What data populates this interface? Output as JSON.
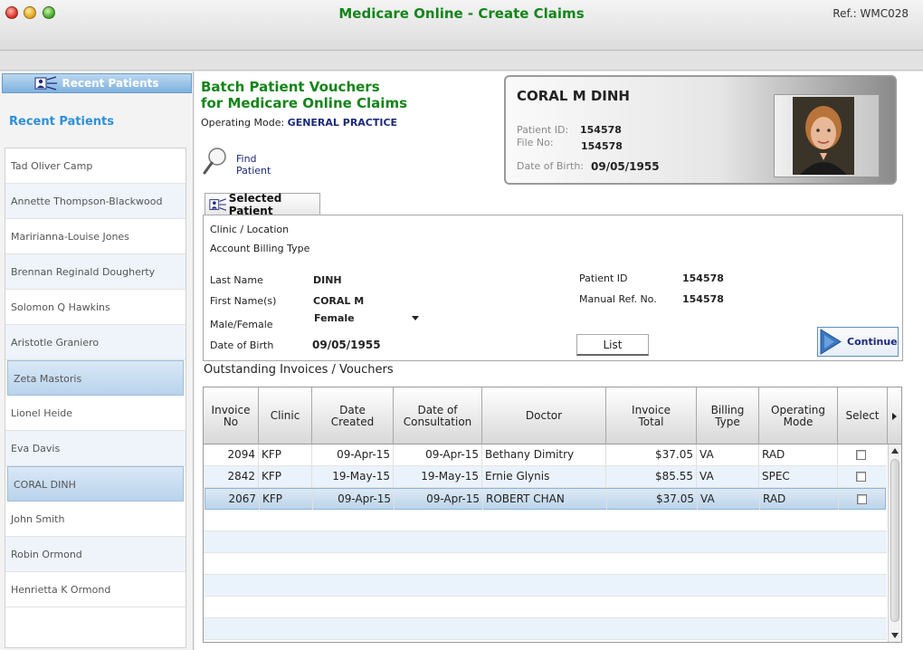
{
  "window": {
    "title": "Medicare Online - Create Claims",
    "ref": "Ref.: WMC028",
    "colors": {
      "title_green": "#14851a",
      "accent_blue": "#2e8fd8",
      "navy": "#1c2a7a"
    }
  },
  "sidebar": {
    "header": "Recent Patients",
    "title": "Recent Patients",
    "items": [
      "Tad Oliver Camp",
      "Annette Thompson-Blackwood",
      "Maririanna-Louise Jones",
      "Brennan Reginald Dougherty",
      "Solomon Q Hawkins",
      "Aristotle Graniero",
      "Zeta Mastoris",
      "Lionel Heide",
      "Eva Davis",
      "CORAL DINH",
      "John Smith",
      "Robin Ormond",
      "Henrietta K Ormond"
    ]
  },
  "main": {
    "batch_title_line1": "Batch Patient Vouchers",
    "batch_title_line2": "for Medicare Online Claims",
    "op_mode_label": "Operating Mode:",
    "op_mode_value": "GENERAL PRACTICE",
    "find_patient": "Find Patient"
  },
  "patient_card": {
    "name": "CORAL M DINH",
    "patient_id_label": "Patient ID:",
    "patient_id": "154578",
    "file_no_label": "File No:",
    "file_no": "154578",
    "dob_label": "Date of Birth:",
    "dob": "09/05/1955"
  },
  "selected_patient": {
    "tab": "Selected Patient",
    "clinic_label": "Clinic / Location",
    "billing_label": "Account Billing Type",
    "last_name_label": "Last Name",
    "last_name": "DINH",
    "first_name_label": "First Name(s)",
    "first_name": "CORAL M",
    "gender_label": "Male/Female",
    "gender": "Female",
    "dob_label": "Date of Birth",
    "dob": "09/05/1955",
    "patient_id_label": "Patient ID",
    "patient_id": "154578",
    "manual_ref_label": "Manual Ref. No.",
    "manual_ref": "154578",
    "list_button": "List",
    "continue_button": "Continue"
  },
  "invoices": {
    "title": "Outstanding Invoices / Vouchers",
    "columns": [
      "Invoice No",
      "Clinic",
      "Date Created",
      "Date of Consultation",
      "Doctor",
      "Invoice Total",
      "Billing Type",
      "Operating Mode",
      "Select"
    ],
    "rows": [
      {
        "invoice_no": "2094",
        "clinic": "KFP",
        "date_created": "09-Apr-15",
        "date_consult": "09-Apr-15",
        "doctor": "Bethany Dimitry",
        "total": "$37.05",
        "billing": "VA",
        "mode": "RAD",
        "selected": false
      },
      {
        "invoice_no": "2842",
        "clinic": "KFP",
        "date_created": "19-May-15",
        "date_consult": "19-May-15",
        "doctor": "Ernie Glynis",
        "total": "$85.55",
        "billing": "VA",
        "mode": "SPEC",
        "selected": false
      },
      {
        "invoice_no": "2067",
        "clinic": "KFP",
        "date_created": "09-Apr-15",
        "date_consult": "09-Apr-15",
        "doctor": "ROBERT CHAN",
        "total": "$37.05",
        "billing": "VA",
        "mode": "RAD",
        "selected": false
      }
    ]
  }
}
